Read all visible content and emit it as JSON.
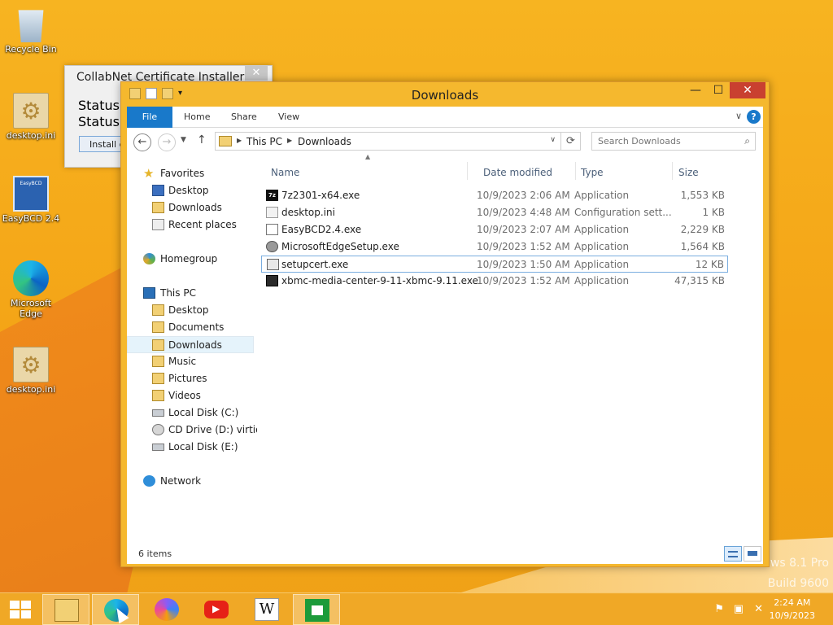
{
  "desktop": {
    "icons": [
      {
        "label": "Recycle Bin",
        "icon": "recycle-bin-icon"
      },
      {
        "label": "desktop.ini",
        "icon": "ini-file-icon"
      },
      {
        "label": "EasyBCD 2.4",
        "icon": "easybcd-icon"
      },
      {
        "label": "Microsoft Edge",
        "icon": "edge-icon"
      },
      {
        "label": "desktop.ini",
        "icon": "ini-file-icon"
      }
    ],
    "watermark_line1": "ws 8.1 Pro",
    "watermark_line2": "Build 9600"
  },
  "installer": {
    "title": "CollabNet Certificate Installer",
    "close_glyph": "✕",
    "status1": "Status",
    "status2": "Status",
    "button": "Install ce"
  },
  "explorer": {
    "title": "Downloads",
    "window_buttons": {
      "minimize": "—",
      "maximize": "☐",
      "close": "✕"
    },
    "ribbon_tabs": [
      "File",
      "Home",
      "Share",
      "View"
    ],
    "ribbon_expand": "∨",
    "help": "?",
    "address": {
      "crumbs": [
        "This PC",
        "Downloads"
      ]
    },
    "search_placeholder": "Search Downloads",
    "nav": {
      "favorites": {
        "label": "Favorites",
        "items": [
          "Desktop",
          "Downloads",
          "Recent places"
        ]
      },
      "homegroup": "Homegroup",
      "this_pc": {
        "label": "This PC",
        "items": [
          "Desktop",
          "Documents",
          "Downloads",
          "Music",
          "Pictures",
          "Videos",
          "Local Disk (C:)",
          "CD Drive (D:) virtio-w",
          "Local Disk (E:)"
        ]
      },
      "network": "Network",
      "selected": "Downloads"
    },
    "columns": [
      "Name",
      "Date modified",
      "Type",
      "Size"
    ],
    "files": [
      {
        "name": "7z2301-x64.exe",
        "date": "10/9/2023 2:06 AM",
        "type": "Application",
        "size": "1,553 KB",
        "icon": "7zip-icon"
      },
      {
        "name": "desktop.ini",
        "date": "10/9/2023 4:48 AM",
        "type": "Configuration sett...",
        "size": "1 KB",
        "icon": "ini-file-icon"
      },
      {
        "name": "EasyBCD2.4.exe",
        "date": "10/9/2023 2:07 AM",
        "type": "Application",
        "size": "2,229 KB",
        "icon": "easybcd-icon"
      },
      {
        "name": "MicrosoftEdgeSetup.exe",
        "date": "10/9/2023 1:52 AM",
        "type": "Application",
        "size": "1,564 KB",
        "icon": "edge-setup-icon"
      },
      {
        "name": "setupcert.exe",
        "date": "10/9/2023 1:50 AM",
        "type": "Application",
        "size": "12 KB",
        "icon": "exe-icon"
      },
      {
        "name": "xbmc-media-center-9-11-xbmc-9.11.exe",
        "date": "10/9/2023 1:52 AM",
        "type": "Application",
        "size": "47,315 KB",
        "icon": "xbmc-icon"
      }
    ],
    "selected_file": "setupcert.exe",
    "status": "6 items"
  },
  "taskbar": {
    "apps": [
      "File Explorer",
      "Microsoft Edge",
      "Copilot",
      "YouTube",
      "Wikipedia",
      "Store"
    ],
    "wiki_glyph": "W",
    "time": "2:24 AM",
    "date": "10/9/2023"
  },
  "colors": {
    "accent": "#1979ca",
    "desktop": "#f5a91b",
    "close": "#c94030"
  }
}
